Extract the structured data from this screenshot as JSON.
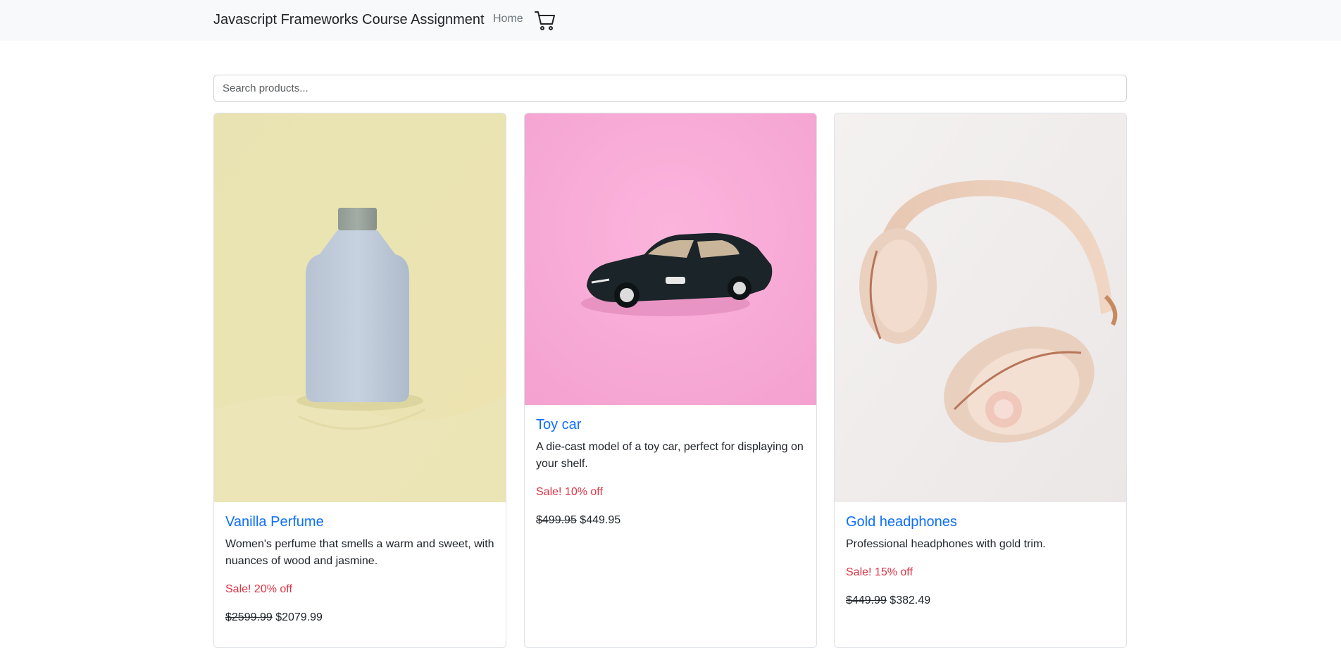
{
  "navbar": {
    "brand": "Javascript Frameworks Course Assignment",
    "home": "Home",
    "cart_icon": "cart-icon"
  },
  "search": {
    "placeholder": "Search products...",
    "value": ""
  },
  "products": [
    {
      "title": "Vanilla Perfume",
      "description": "Women's perfume that smells a warm and sweet, with nuances of wood and jasmine.",
      "sale": "Sale! 20% off",
      "old_price": "$2599.99",
      "price": "$2079.99",
      "image": "perfume-bottle-image"
    },
    {
      "title": "Toy car",
      "description": "A die-cast model of a toy car, perfect for displaying on your shelf.",
      "sale": "Sale! 10% off",
      "old_price": "$499.95",
      "price": "$449.95",
      "image": "toy-car-image"
    },
    {
      "title": "Gold headphones",
      "description": "Professional headphones with gold trim.",
      "sale": "Sale! 15% off",
      "old_price": "$449.99",
      "price": "$382.49",
      "image": "headphones-image"
    }
  ],
  "colors": {
    "navbar_bg": "#f8f9fa",
    "title_link": "#0d6efd",
    "sale": "#dc3545",
    "perfume_bg": "#e8e2b2",
    "toycar_bg": "#f7a8d6",
    "headphones_bg": "#f3f0ef"
  }
}
